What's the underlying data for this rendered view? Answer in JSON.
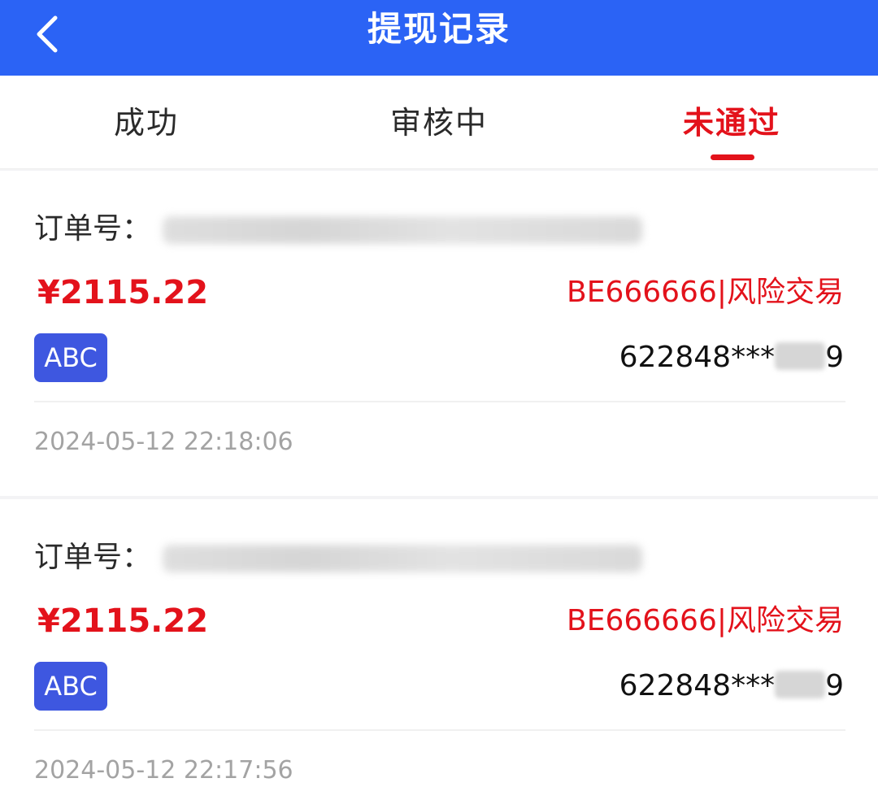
{
  "header": {
    "title": "提现记录",
    "back_icon": "chevron-left-icon"
  },
  "tabs": [
    {
      "label": "成功",
      "active": false
    },
    {
      "label": "审核中",
      "active": false
    },
    {
      "label": "未通过",
      "active": true
    }
  ],
  "records": [
    {
      "order_label": "订单号：",
      "amount": "¥2115.22",
      "reason": "BE666666|风险交易",
      "bank": "ABC",
      "card_prefix": "622848***",
      "card_suffix": "9",
      "time": "2024-05-12 22:18:06"
    },
    {
      "order_label": "订单号：",
      "amount": "¥2115.22",
      "reason": "BE666666|风险交易",
      "bank": "ABC",
      "card_prefix": "622848***",
      "card_suffix": "9",
      "time": "2024-05-12 22:17:56"
    }
  ],
  "colors": {
    "header_bg": "#2b63f5",
    "accent_red": "#e3121b",
    "bank_badge": "#3e57e0",
    "muted_text": "#a3a3a3"
  }
}
